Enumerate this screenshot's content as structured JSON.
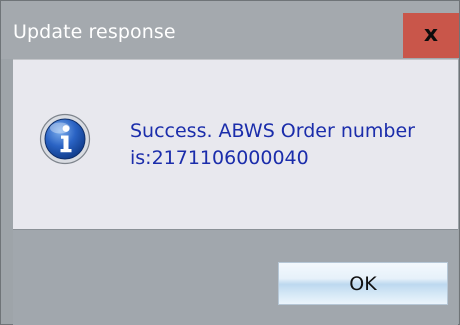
{
  "dialog": {
    "title": "Update response",
    "close_glyph": "x",
    "message_line1": "Success. ABWS Order number",
    "message_line2": "is:2171106000040",
    "icon": "information-icon",
    "ok_label": "OK"
  },
  "colors": {
    "title_bar": "#a4a9ae",
    "close_button": "#c9564a",
    "content_bg": "#e8e8ee",
    "message_text": "#1b2dab",
    "footer_bg": "#a1a7ad",
    "ok_button_top": "#f4f9fd",
    "ok_button_mid": "#bdd8ef"
  }
}
